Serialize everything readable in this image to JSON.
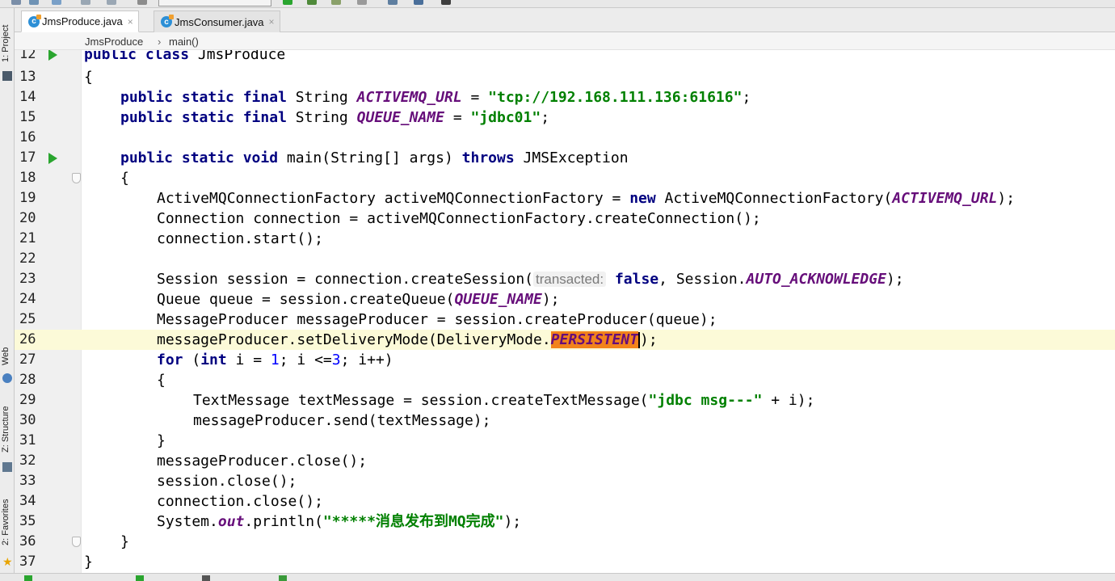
{
  "tabs": [
    {
      "label": "JmsProduce.java",
      "active": true
    },
    {
      "label": "JmsConsumer.java",
      "active": false
    }
  ],
  "tab_close_glyph": "×",
  "file_icon_letter": "c",
  "breadcrumb": [
    "JmsProduce",
    "main()"
  ],
  "breadcrumb_separator": "›",
  "side_tools": [
    "1: Project",
    "Web",
    "Z: Structure",
    "2: Favorites"
  ],
  "line_numbers": [
    "12",
    "13",
    "14",
    "15",
    "16",
    "17",
    "18",
    "19",
    "20",
    "21",
    "22",
    "23",
    "24",
    "25",
    "26",
    "27",
    "28",
    "29",
    "30",
    "31",
    "32",
    "33",
    "34",
    "35",
    "36",
    "37"
  ],
  "code": {
    "l12": {
      "kw": "public class",
      "name": " JmsProduce"
    },
    "l13": {
      "text": "{"
    },
    "l14": {
      "kw": "public static final",
      "type": " String ",
      "const": "ACTIVEMQ_URL",
      "eq": " = ",
      "str": "\"tcp://192.168.111.136:61616\"",
      "end": ";"
    },
    "l15": {
      "kw": "public static final",
      "type": " String ",
      "const": "QUEUE_NAME",
      "eq": " = ",
      "str": "\"jdbc01\"",
      "end": ";"
    },
    "l17": {
      "kw": "public static void",
      "sig": " main(String[] args) ",
      "kw2": "throws",
      "exc": " JMSException"
    },
    "l18": {
      "text": "{"
    },
    "l19": {
      "pre": "ActiveMQConnectionFactory activeMQConnectionFactory = ",
      "kw": "new",
      "post": " ActiveMQConnectionFactory(",
      "const": "ACTIVEMQ_URL",
      "end": ");"
    },
    "l20": {
      "text": "Connection connection = activeMQConnectionFactory.createConnection();"
    },
    "l21": {
      "text": "connection.start();"
    },
    "l23": {
      "pre": "Session session = connection.createSession(",
      "hint": "transacted:",
      "kw": "false",
      "mid": ", Session.",
      "const": "AUTO_ACKNOWLEDGE",
      "end": ");"
    },
    "l24": {
      "pre": "Queue queue = session.createQueue(",
      "const": "QUEUE_NAME",
      "end": ");"
    },
    "l25": {
      "text": "MessageProducer messageProducer = session.createProducer(queue);"
    },
    "l26": {
      "pre": "messageProducer.setDeliveryMode(DeliveryMode.",
      "const": "PERSISTENT",
      "end": ");"
    },
    "l27": {
      "kw": "for",
      "a": " (",
      "kw2": "int",
      "b": " i = ",
      "n1": "1",
      "c": "; i <=",
      "n2": "3",
      "d": "; i++)"
    },
    "l28": {
      "text": "{"
    },
    "l29": {
      "pre": "TextMessage textMessage = session.createTextMessage(",
      "str": "\"jdbc msg---\"",
      "end": " + i);"
    },
    "l30": {
      "text": "messageProducer.send(textMessage);"
    },
    "l31": {
      "text": "}"
    },
    "l32": {
      "text": "messageProducer.close();"
    },
    "l33": {
      "text": "session.close();"
    },
    "l34": {
      "text": "connection.close();"
    },
    "l35": {
      "pre": "System.",
      "st": "out",
      "mid": ".println(",
      "str": "\"*****消息发布到MQ完成\"",
      "end": ");"
    },
    "l36": {
      "text": "}"
    },
    "l37": {
      "text": "}"
    }
  },
  "colors": {
    "keyword": "#000080",
    "string": "#008000",
    "constant": "#660e7a",
    "number": "#0000ff",
    "current_line": "#fcfad8",
    "selection": "#f2831b",
    "run_arrow": "#2aa52f"
  },
  "icons": [
    "run-gutter-icon",
    "fold-marker-icon",
    "java-class-icon",
    "favorites-star-icon"
  ]
}
